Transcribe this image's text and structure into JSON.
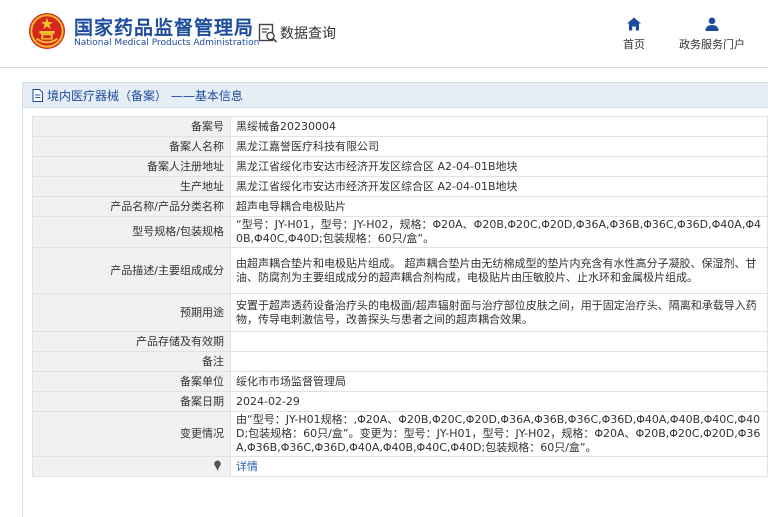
{
  "header": {
    "title_cn": "国家药品监督管理局",
    "title_en": "National Medical Products Administration",
    "query_label": "数据查询",
    "nav": [
      {
        "label": "首页",
        "icon": "home-icon"
      },
      {
        "label": "政务服务门户",
        "icon": "user-icon"
      }
    ]
  },
  "panel": {
    "title": "境内医疗器械（备案） ——基本信息"
  },
  "rows": [
    {
      "key": "备案号",
      "value": "黑绥械备20230004"
    },
    {
      "key": "备案人名称",
      "value": "黑龙江嘉誉医疗科技有限公司"
    },
    {
      "key": "备案人注册地址",
      "value": "黑龙江省绥化市安达市经济开发区综合区 A2-04-01B地块"
    },
    {
      "key": "生产地址",
      "value": "黑龙江省绥化市安达市经济开发区综合区 A2-04-01B地块"
    },
    {
      "key": "产品名称/产品分类名称",
      "value": "超声电导耦合电极贴片"
    },
    {
      "key": "型号规格/包装规格",
      "value": "“型号：JY-H01，型号：JY-H02，规格：Φ20A、Φ20B,Φ20C,Φ20D,Φ36A,Φ36B,Φ36C,Φ36D,Φ40A,Φ40B,Φ40C,Φ40D;包装规格：60只/盒”。"
    },
    {
      "key": "产品描述/主要组成成分",
      "value": "由超声耦合垫片和电极贴片组成。 超声耦合垫片由无纺棉成型的垫片内充含有水性高分子凝胶、保湿剂、甘油、防腐剂为主要组成成分的超声耦合剂构成，电极贴片由压敏胶片、止水环和金属极片组成。"
    },
    {
      "key": "预期用途",
      "value": "安置于超声透药设备治疗头的电极面/超声辐射面与治疗部位皮肤之间，用于固定治疗头、隔离和承载导入药物，传导电刺激信号，改善探头与患者之间的超声耦合效果。"
    },
    {
      "key": "产品存储及有效期",
      "value": ""
    },
    {
      "key": "备注",
      "value": ""
    },
    {
      "key": "备案单位",
      "value": "绥化市市场监督管理局"
    },
    {
      "key": "备案日期",
      "value": "2024-02-29"
    },
    {
      "key": "变更情况",
      "value": "由“型号：JY-H01规格：,Φ20A、Φ20B,Φ20C,Φ20D,Φ36A,Φ36B,Φ36C,Φ36D,Φ40A,Φ40B,Φ40C,Φ40D;包装规格：60只/盒”。变更为：型号：JY-H01，型号：JY-H02，规格：Φ20A、Φ20B,Φ20C,Φ20D,Φ36A,Φ36B,Φ36C,Φ36D,Φ40A,Φ40B,Φ40C,Φ40D;包装规格：60只/盒”。"
    }
  ],
  "detail_link": "详情",
  "colors": {
    "brand": "#1d4c9c",
    "emblem_red": "#d7261c",
    "emblem_gold": "#f2c230",
    "link": "#2762b5"
  }
}
